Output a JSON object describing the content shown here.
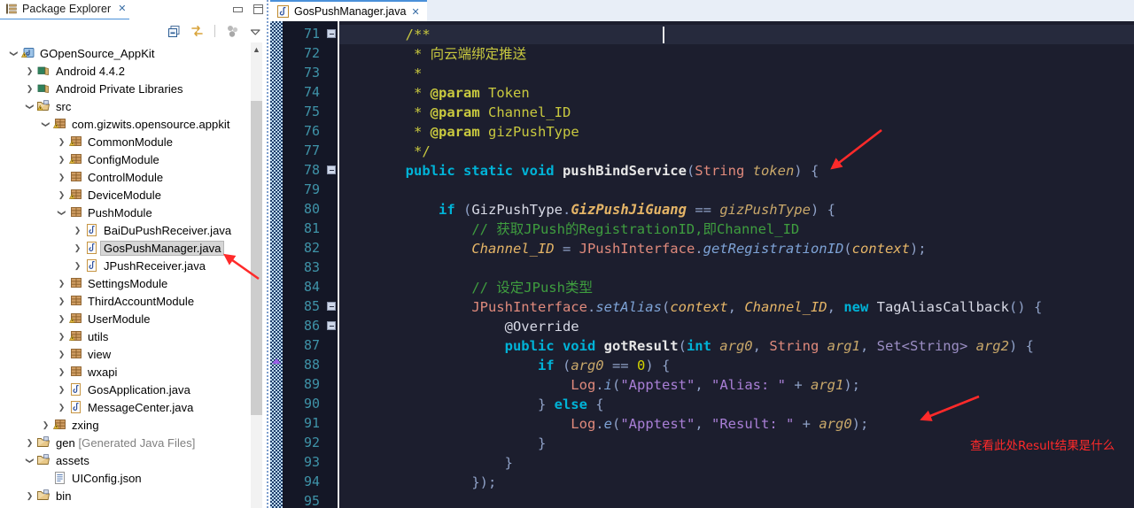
{
  "explorer": {
    "tab_title": "Package Explorer",
    "tab_close": "✕",
    "toolbar": {
      "collapse_all": "collapse-all-icon",
      "link_with_editor": "link-with-editor-icon",
      "focus_active_task": "focus-on-active-task-icon",
      "view_menu": "view-menu-icon"
    },
    "window_buttons": {
      "minimize": "minimize-icon",
      "maximize": "maximize-icon"
    },
    "tree": [
      {
        "label": "GOpenSource_AppKit",
        "indent": 0,
        "arrow": "down",
        "icon": "java-project",
        "selected": false
      },
      {
        "label": "Android 4.4.2",
        "indent": 1,
        "arrow": "right",
        "icon": "library",
        "selected": false
      },
      {
        "label": "Android Private Libraries",
        "indent": 1,
        "arrow": "right",
        "icon": "library",
        "selected": false
      },
      {
        "label": "src",
        "indent": 1,
        "arrow": "down",
        "icon": "source-folder",
        "selected": false
      },
      {
        "label": "com.gizwits.opensource.appkit",
        "indent": 2,
        "arrow": "down",
        "icon": "package-warn",
        "selected": false
      },
      {
        "label": "CommonModule",
        "indent": 3,
        "arrow": "right",
        "icon": "package-warn",
        "selected": false
      },
      {
        "label": "ConfigModule",
        "indent": 3,
        "arrow": "right",
        "icon": "package-warn",
        "selected": false
      },
      {
        "label": "ControlModule",
        "indent": 3,
        "arrow": "right",
        "icon": "package",
        "selected": false
      },
      {
        "label": "DeviceModule",
        "indent": 3,
        "arrow": "right",
        "icon": "package-warn",
        "selected": false
      },
      {
        "label": "PushModule",
        "indent": 3,
        "arrow": "down",
        "icon": "package",
        "selected": false
      },
      {
        "label": "BaiDuPushReceiver.java",
        "indent": 4,
        "arrow": "right",
        "icon": "java-file",
        "selected": false
      },
      {
        "label": "GosPushManager.java",
        "indent": 4,
        "arrow": "right",
        "icon": "java-file",
        "selected": true
      },
      {
        "label": "JPushReceiver.java",
        "indent": 4,
        "arrow": "right",
        "icon": "java-file",
        "selected": false
      },
      {
        "label": "SettingsModule",
        "indent": 3,
        "arrow": "right",
        "icon": "package",
        "selected": false
      },
      {
        "label": "ThirdAccountModule",
        "indent": 3,
        "arrow": "right",
        "icon": "package",
        "selected": false
      },
      {
        "label": "UserModule",
        "indent": 3,
        "arrow": "right",
        "icon": "package-warn",
        "selected": false
      },
      {
        "label": "utils",
        "indent": 3,
        "arrow": "right",
        "icon": "package-warn",
        "selected": false
      },
      {
        "label": "view",
        "indent": 3,
        "arrow": "right",
        "icon": "package",
        "selected": false
      },
      {
        "label": "wxapi",
        "indent": 3,
        "arrow": "right",
        "icon": "package",
        "selected": false
      },
      {
        "label": "GosApplication.java",
        "indent": 3,
        "arrow": "right",
        "icon": "java-file",
        "selected": false
      },
      {
        "label": "MessageCenter.java",
        "indent": 3,
        "arrow": "right",
        "icon": "java-file",
        "selected": false
      },
      {
        "label": "zxing",
        "indent": 2,
        "arrow": "right",
        "icon": "package-warn",
        "selected": false
      },
      {
        "label": "gen ",
        "label_dim": "[Generated Java Files]",
        "indent": 1,
        "arrow": "right",
        "icon": "source-folder-gen",
        "selected": false
      },
      {
        "label": "assets",
        "indent": 1,
        "arrow": "down",
        "icon": "folder",
        "selected": false
      },
      {
        "label": "UIConfig.json",
        "indent": 2,
        "arrow": "none",
        "icon": "json-file",
        "selected": false
      },
      {
        "label": "bin",
        "indent": 1,
        "arrow": "right",
        "icon": "folder",
        "selected": false
      }
    ]
  },
  "editor": {
    "tab_title": "GosPushManager.java",
    "tab_close": "✕",
    "first_line": 71,
    "current_line": 71,
    "lines": [
      {
        "n": 71,
        "fold": true,
        "html": "        <span class=\"t-jdoc\">/**</span>"
      },
      {
        "n": 72,
        "fold": false,
        "html": "         <span class=\"t-jdoc\">* 向云端绑定推送</span>"
      },
      {
        "n": 73,
        "fold": false,
        "html": "         <span class=\"t-jdoc\">*</span>"
      },
      {
        "n": 74,
        "fold": false,
        "html": "         <span class=\"t-jdoc\">* </span><span class=\"t-jtag\">@param</span><span class=\"t-jdoc\"> Token</span>"
      },
      {
        "n": 75,
        "fold": false,
        "html": "         <span class=\"t-jdoc\">* </span><span class=\"t-jtag\">@param</span><span class=\"t-jdoc\"> Channel_ID</span>"
      },
      {
        "n": 76,
        "fold": false,
        "html": "         <span class=\"t-jdoc\">* </span><span class=\"t-jtag\">@param</span><span class=\"t-jdoc\"> gizPushType</span>"
      },
      {
        "n": 77,
        "fold": false,
        "html": "         <span class=\"t-jdoc\">*/</span>"
      },
      {
        "n": 78,
        "fold": true,
        "html": "        <span class=\"t-kw\">public static void </span><span class=\"t-mth\">pushBindService</span><span class=\"t-lpar\">(</span><span class=\"t-type\">String</span><span class=\"t-param\"> token</span><span class=\"t-lpar\">) {</span>"
      },
      {
        "n": 79,
        "fold": false,
        "html": ""
      },
      {
        "n": 80,
        "fold": false,
        "html": "            <span class=\"t-kw\">if</span><span class=\"t-lpar\"> (</span><span class=\"t-plain\">GizPushType</span><span class=\"t-lpar\">.</span><span class=\"t-sfld\">GizPushJiGuang</span><span class=\"t-lpar\"> == </span><span class=\"t-param\">gizPushType</span><span class=\"t-lpar\">) {</span>"
      },
      {
        "n": 81,
        "fold": false,
        "html": "                <span class=\"t-cmt\">// 获取JPush的RegistrationID,即Channel_ID</span>"
      },
      {
        "n": 82,
        "fold": false,
        "html": "                <span class=\"t-fld\">Channel_ID</span><span class=\"t-lpar\"> = </span><span class=\"t-type\">JPushInterface</span><span class=\"t-lpar\">.</span><span class=\"t-imth\">getRegistrationID</span><span class=\"t-lpar\">(</span><span class=\"t-fld\">context</span><span class=\"t-lpar\">);</span>"
      },
      {
        "n": 83,
        "fold": false,
        "html": ""
      },
      {
        "n": 84,
        "fold": false,
        "html": "                <span class=\"t-cmt\">// 设定JPush类型</span>"
      },
      {
        "n": 85,
        "fold": true,
        "html": "                <span class=\"t-type\">JPushInterface</span><span class=\"t-lpar\">.</span><span class=\"t-imth\">setAlias</span><span class=\"t-lpar\">(</span><span class=\"t-fld\">context</span><span class=\"t-lpar\">, </span><span class=\"t-fld\">Channel_ID</span><span class=\"t-lpar\">, </span><span class=\"t-kw\">new</span><span class=\"t-plain\"> TagAliasCallback</span><span class=\"t-lpar\">() {</span>"
      },
      {
        "n": 86,
        "fold": true,
        "html": "                    <span class=\"t-ann\">@Override</span>"
      },
      {
        "n": 87,
        "fold": false,
        "html": "                    <span class=\"t-kw\">public void </span><span class=\"t-mth\">gotResult</span><span class=\"t-lpar\">(</span><span class=\"t-kw\">int</span><span class=\"t-param\"> arg0</span><span class=\"t-lpar\">, </span><span class=\"t-type\">String</span><span class=\"t-param\"> arg1</span><span class=\"t-lpar\">, </span><span class=\"t-gen\">Set&lt;String&gt;</span><span class=\"t-param\"> arg2</span><span class=\"t-lpar\">) {</span>"
      },
      {
        "n": 88,
        "fold": false,
        "html": "                        <span class=\"t-kw\">if</span><span class=\"t-lpar\"> (</span><span class=\"t-param\">arg0</span><span class=\"t-lpar\"> == </span><span class=\"t-num\">0</span><span class=\"t-lpar\">) {</span>"
      },
      {
        "n": 89,
        "fold": false,
        "html": "                            <span class=\"t-type\">Log</span><span class=\"t-lpar\">.</span><span class=\"t-imth\">i</span><span class=\"t-lpar\">(</span><span class=\"t-str\">\"Apptest\"</span><span class=\"t-lpar\">, </span><span class=\"t-str\">\"Alias: \"</span><span class=\"t-lpar\"> + </span><span class=\"t-param\">arg1</span><span class=\"t-lpar\">);</span>"
      },
      {
        "n": 90,
        "fold": false,
        "html": "                        <span class=\"t-lpar\">} </span><span class=\"t-kw\">else</span><span class=\"t-lpar\"> {</span>"
      },
      {
        "n": 91,
        "fold": false,
        "html": "                            <span class=\"t-type\">Log</span><span class=\"t-lpar\">.</span><span class=\"t-imth\">e</span><span class=\"t-lpar\">(</span><span class=\"t-str\">\"Apptest\"</span><span class=\"t-lpar\">, </span><span class=\"t-str\">\"Result: \"</span><span class=\"t-lpar\"> + </span><span class=\"t-param\">arg0</span><span class=\"t-lpar\">);</span>"
      },
      {
        "n": 92,
        "fold": false,
        "html": "                        <span class=\"t-lpar\">}</span>"
      },
      {
        "n": 93,
        "fold": false,
        "html": "                    <span class=\"t-lpar\">}</span>"
      },
      {
        "n": 94,
        "fold": false,
        "html": "                <span class=\"t-lpar\">});</span>"
      },
      {
        "n": 95,
        "fold": false,
        "html": ""
      }
    ]
  },
  "annotations": {
    "color": "#ff2a2a",
    "items": [
      {
        "name": "arrow-to-pushbindservice",
        "type": "arrow"
      },
      {
        "name": "arrow-to-jpushreceiver",
        "type": "arrow"
      },
      {
        "name": "arrow-to-log-result",
        "type": "arrow"
      },
      {
        "name": "note-check-result",
        "type": "text",
        "text": "查看此处Result结果是什么"
      }
    ]
  }
}
